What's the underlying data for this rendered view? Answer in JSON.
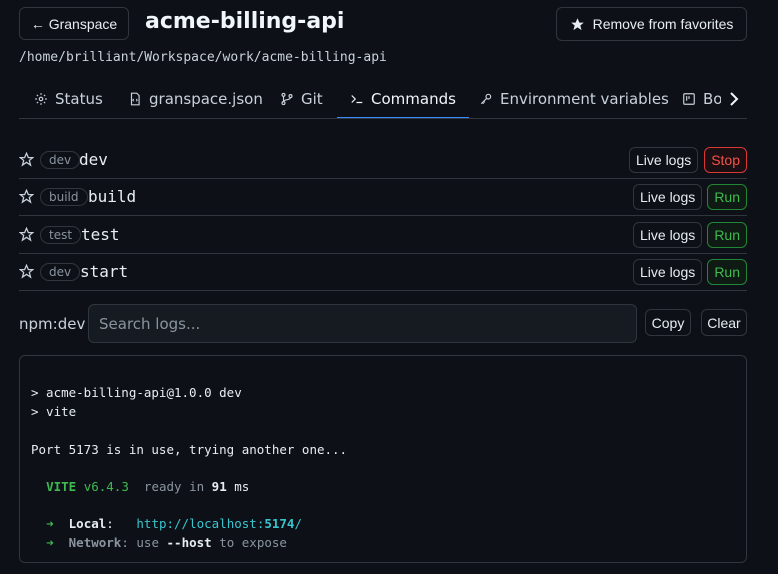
{
  "header": {
    "back_label": "← Granspace",
    "title": "acme-billing-api",
    "favorite_label": "Remove from favorites",
    "path": "/home/brilliant/Workspace/work/acme-billing-api"
  },
  "tabs": [
    {
      "label": "Status",
      "icon": "gear-icon"
    },
    {
      "label": "granspace.json",
      "icon": "file-code-icon"
    },
    {
      "label": "Git",
      "icon": "git-branch-icon"
    },
    {
      "label": "Commands",
      "icon": "terminal-icon",
      "active": true
    },
    {
      "label": "Environment variables",
      "icon": "key-icon"
    },
    {
      "label": "Bo",
      "icon": "board-icon"
    }
  ],
  "commands": [
    {
      "tag": "dev",
      "name": "dev",
      "live_label": "Live logs",
      "action_label": "Stop",
      "running": true
    },
    {
      "tag": "build",
      "name": "build",
      "live_label": "Live logs",
      "action_label": "Run",
      "running": false
    },
    {
      "tag": "test",
      "name": "test",
      "live_label": "Live logs",
      "action_label": "Run",
      "running": false
    },
    {
      "tag": "dev",
      "name": "start",
      "live_label": "Live logs",
      "action_label": "Run",
      "running": false
    }
  ],
  "logs": {
    "source_label": "npm:dev",
    "search_placeholder": "Search logs...",
    "copy_label": "Copy",
    "clear_label": "Clear",
    "line1": "> acme-billing-api@1.0.0 dev",
    "line2": "> vite",
    "line3": "Port 5173 is in use, trying another one...",
    "vite_name": "VITE",
    "vite_version": "v6.4.3",
    "ready_text": "ready in",
    "ready_ms": "91",
    "ms_unit": "ms",
    "arrow": "➜",
    "local_label": "Local",
    "local_url_prefix": "http://localhost:",
    "local_port": "5174",
    "local_url_suffix": "/",
    "network_label": "Network",
    "network_use": "use",
    "network_flag": "--host",
    "network_tail": "to expose"
  },
  "colors": {
    "background": "#0d1117",
    "border": "#30363d",
    "accent": "#388bfd",
    "stop": "#f85149",
    "run": "#3fb950"
  }
}
